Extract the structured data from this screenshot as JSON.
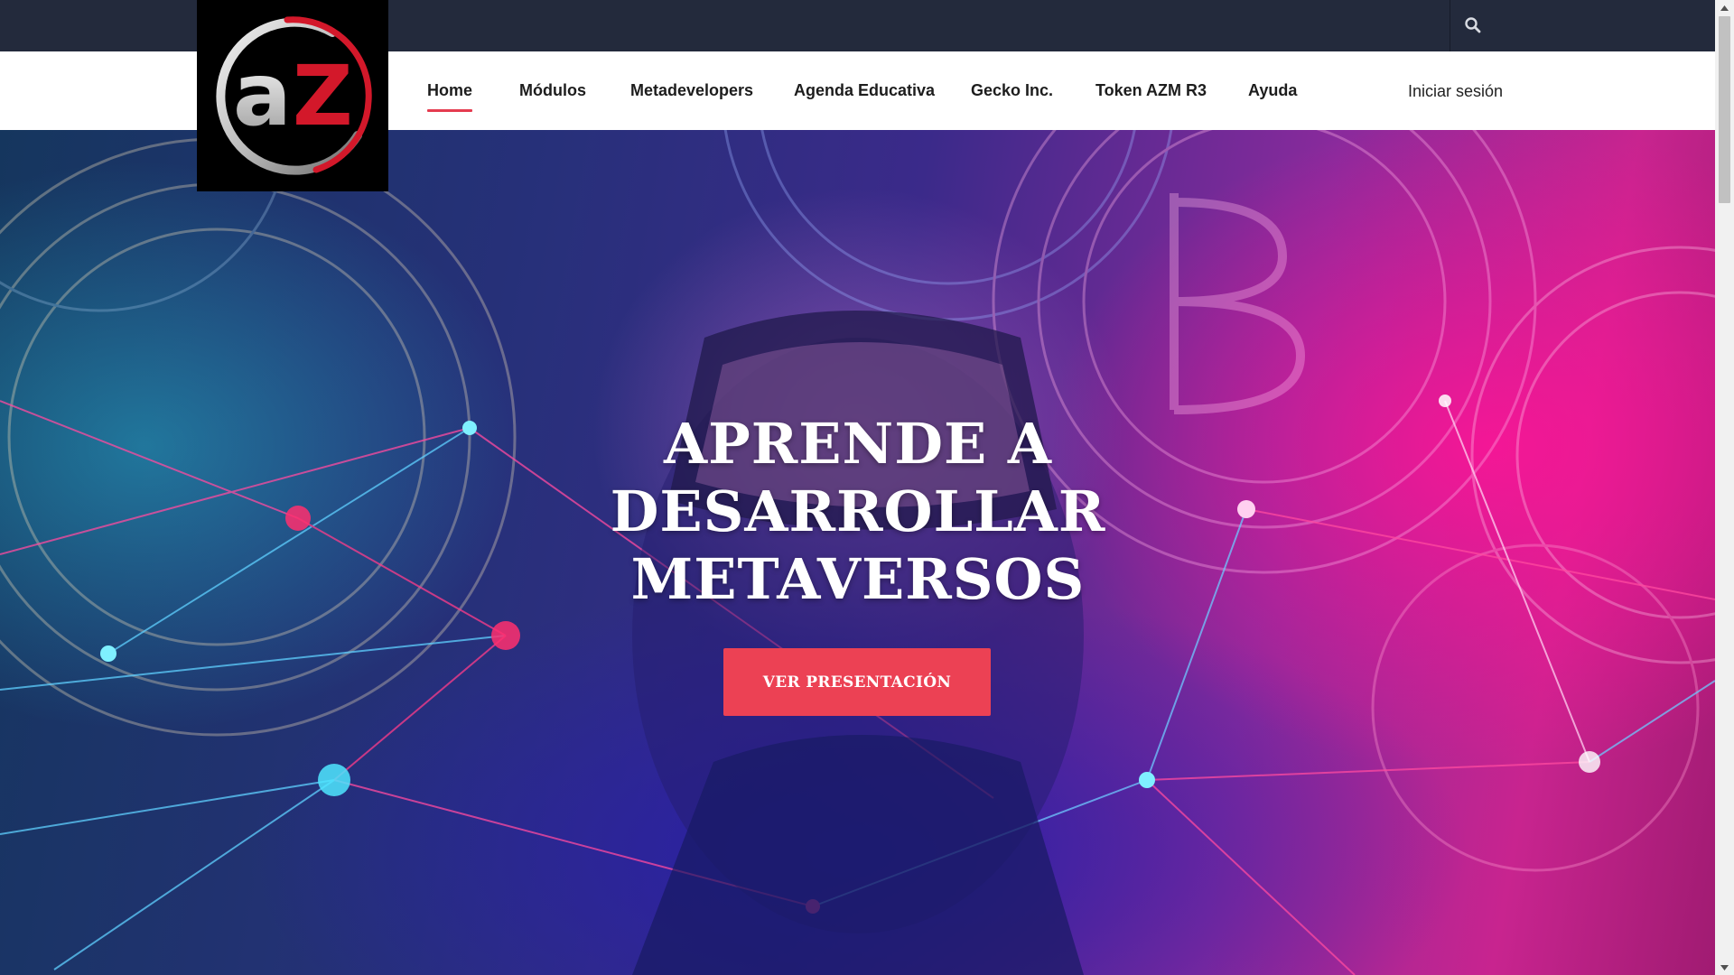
{
  "brand": {
    "logo_icon": "az-logo",
    "logo_letters": "aZ",
    "accent_color": "#e53b4f"
  },
  "topbar": {
    "search_icon": "search-icon"
  },
  "nav": {
    "items": [
      {
        "label": "Home",
        "active": true
      },
      {
        "label": "Módulos"
      },
      {
        "label": "Metadevelopers"
      },
      {
        "label": "Agenda Educativa"
      },
      {
        "label": "Gecko Inc."
      },
      {
        "label": "Token AZM R3"
      },
      {
        "label": "Ayuda"
      }
    ],
    "login_label": "Iniciar sesión"
  },
  "hero": {
    "title_lines": [
      "APRENDE A",
      "DESARROLLAR",
      "METAVERSOS"
    ],
    "cta_label": "VER PRESENTACIÓN",
    "cta_color": "#ec4154"
  }
}
